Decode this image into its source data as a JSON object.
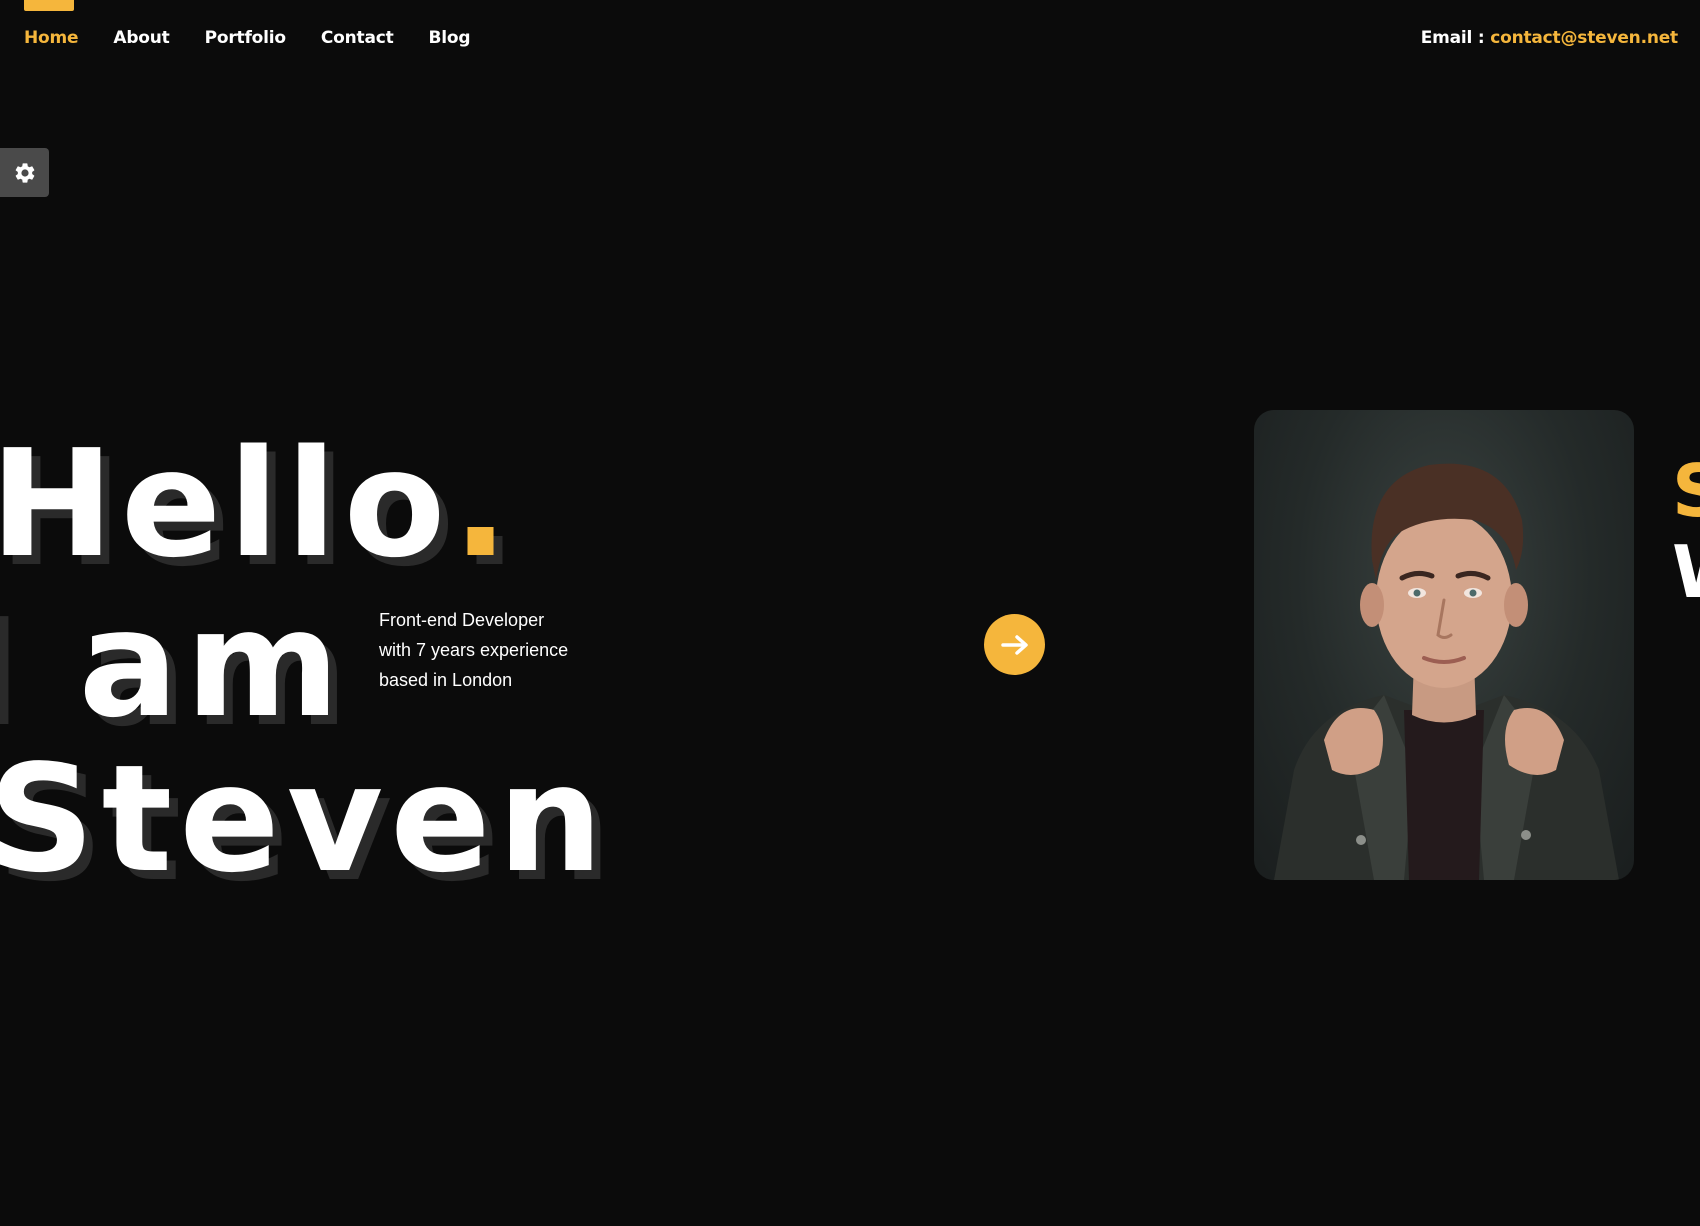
{
  "nav": {
    "items": [
      {
        "label": "Home",
        "active": true
      },
      {
        "label": "About",
        "active": false
      },
      {
        "label": "Portfolio",
        "active": false
      },
      {
        "label": "Contact",
        "active": false
      },
      {
        "label": "Blog",
        "active": false
      }
    ]
  },
  "contact": {
    "label": "Email :",
    "email": "contact@steven.net"
  },
  "settings": {
    "icon": "gear-icon"
  },
  "hero": {
    "line1": "Hello",
    "dot": ".",
    "line2": "I am",
    "line3": "Steven",
    "intro": [
      "Front-end Developer",
      "with 7 years experience",
      "based in London"
    ],
    "cta_icon": "arrow-right-icon"
  },
  "side_text": {
    "first": "S",
    "second": "W"
  },
  "colors": {
    "background": "#0b0b0b",
    "accent": "#f5b63c",
    "text": "#ffffff",
    "settings_tab": "#4a4a4a",
    "heading_shadow": "#2a2a2a"
  }
}
